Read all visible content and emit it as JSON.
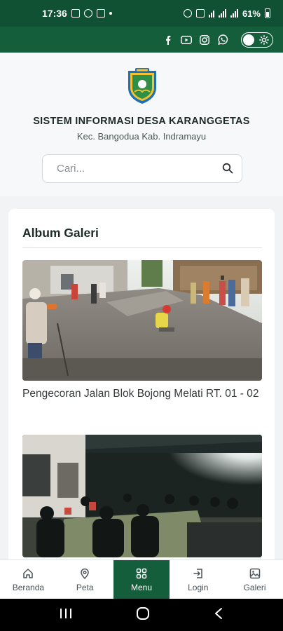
{
  "status_bar": {
    "time": "17:36",
    "battery": "61%"
  },
  "topbar": {
    "social_icons": [
      "facebook-icon",
      "youtube-icon",
      "instagram-icon",
      "whatsapp-icon"
    ],
    "theme_toggle": "light"
  },
  "header": {
    "title": "SISTEM INFORMASI DESA KARANGGETAS",
    "subtitle": "Kec. Bangodua Kab. Indramayu",
    "search_placeholder": "Cari..."
  },
  "gallery": {
    "title": "Album Galeri",
    "items": [
      {
        "caption": "Pengecoran Jalan Blok Bojong Melati RT. 01 - 02"
      },
      {
        "caption": ""
      }
    ]
  },
  "bottom_nav": [
    {
      "label": "Beranda",
      "icon": "home-icon",
      "active": false
    },
    {
      "label": "Peta",
      "icon": "map-pin-icon",
      "active": false
    },
    {
      "label": "Menu",
      "icon": "grid-icon",
      "active": true
    },
    {
      "label": "Login",
      "icon": "login-icon",
      "active": false
    },
    {
      "label": "Galeri",
      "icon": "gallery-icon",
      "active": false
    }
  ],
  "colors": {
    "primary": "#155e3b",
    "status_bar": "#0f5132",
    "background": "#f1f3f5"
  }
}
